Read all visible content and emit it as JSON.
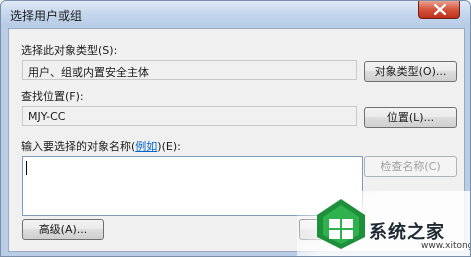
{
  "window": {
    "title": "选择用户或组"
  },
  "object_type": {
    "label": "选择此对象类型(S):",
    "value": "用户、组或内置安全主体",
    "button": "对象类型(O)..."
  },
  "location": {
    "label": "查找位置(F):",
    "value": "MJY-CC",
    "button": "位置(L)..."
  },
  "names": {
    "label_prefix": "输入要选择的对象名称(",
    "label_link": "例如",
    "label_suffix": ")(E):",
    "input_value": "",
    "check_button": "检查名称(C)"
  },
  "footer": {
    "advanced_button": "高级(A)..."
  },
  "watermark": {
    "text": "系统之家",
    "url": "www.xitongzhijia.net"
  },
  "icons": {
    "close": "close-icon",
    "logo": "xitong-logo-icon"
  }
}
